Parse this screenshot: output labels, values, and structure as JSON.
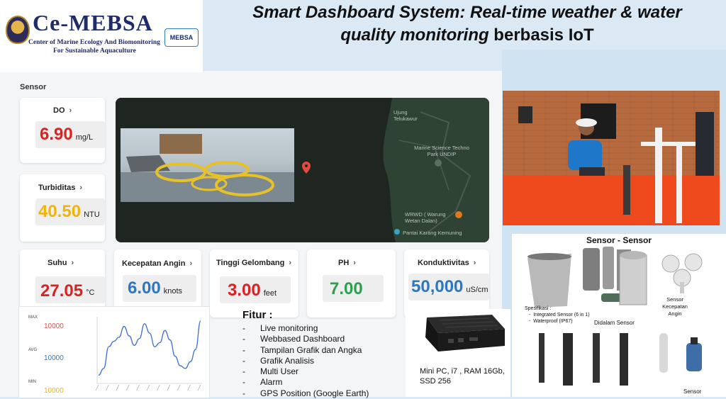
{
  "header": {
    "logo_text": "Ce-MEBSA",
    "logo_sub1": "Center of Marine Ecology And Biomonitoring",
    "logo_sub2": "For Sustainable Aquaculture",
    "logo_badge": "MEBSA",
    "title_line1": "Smart Dashboard System: Real-time weather & water",
    "title_line2_italic": "quality monitoring",
    "title_line2_rest": " berbasis IoT"
  },
  "dashboard": {
    "section_label": "Sensor",
    "sensors": [
      {
        "label": "DO",
        "value": "6.90",
        "unit": "mg/L",
        "color": "#d92323"
      },
      {
        "label": "Turbiditas",
        "value": "40.50",
        "unit": "NTU",
        "color": "#f2b40a"
      },
      {
        "label": "Suhu",
        "value": "27.05",
        "unit": "°C",
        "color": "#d92323"
      },
      {
        "label": "Kecepatan Angin",
        "value": "6.00",
        "unit": "knots",
        "color": "#2b78c2"
      },
      {
        "label": "Tinggi Gelombang",
        "value": "3.00",
        "unit": "feet",
        "color": "#d92323"
      },
      {
        "label": "PH",
        "value": "7.00",
        "unit": "",
        "color": "#2e9e50"
      },
      {
        "label": "Konduktivitas",
        "value": "50,000",
        "unit": "uS/cm",
        "color": "#2b78c2"
      }
    ],
    "map": {
      "labels": [
        "Ujung Telukawur",
        "Marine Science Techno Park UNDIP",
        "WRWD ( Warung Wetan Dalan)",
        "Pantai Karang Kemuning"
      ]
    },
    "chart_legend": [
      {
        "label": "MAX",
        "value": "10000",
        "color": "#d9534f"
      },
      {
        "label": "AVG",
        "value": "10000",
        "color": "#2b78c2"
      },
      {
        "label": "MIN",
        "value": "10000",
        "color": "#f2b40a"
      }
    ]
  },
  "chart_data": {
    "type": "line",
    "series": [
      {
        "values": [
          0.5,
          1.0,
          2.6,
          3.0,
          3.3,
          4.1,
          3.4,
          2.7,
          3.2,
          4.3,
          3.6,
          2.6,
          2.9,
          3.8,
          3.1,
          1.9,
          1.2,
          1.0,
          1.5,
          2.4,
          4.5
        ]
      }
    ]
  },
  "features": {
    "title": "Fitur :",
    "items": [
      "Live monitoring",
      "Webbased Dashboard",
      "Tampilan Grafik dan Angka",
      "Grafik Analisis",
      "Multi User",
      "Alarm",
      "GPS Position (Google Earth)"
    ]
  },
  "hardware": {
    "minipc_text": "Mini PC, i7 , RAM 16Gb, SSD 256",
    "sensor_title": "Sensor - Sensor",
    "spec_title": "Spesifikasi :",
    "spec_items": [
      "Integrated Sensor (6 in 1)",
      "Waterproof (IP67)"
    ],
    "anemometer_label": "Sensor Kecepatan Angin",
    "inside_label": "Didalam Sensor",
    "bottom_label": "Sensor"
  }
}
